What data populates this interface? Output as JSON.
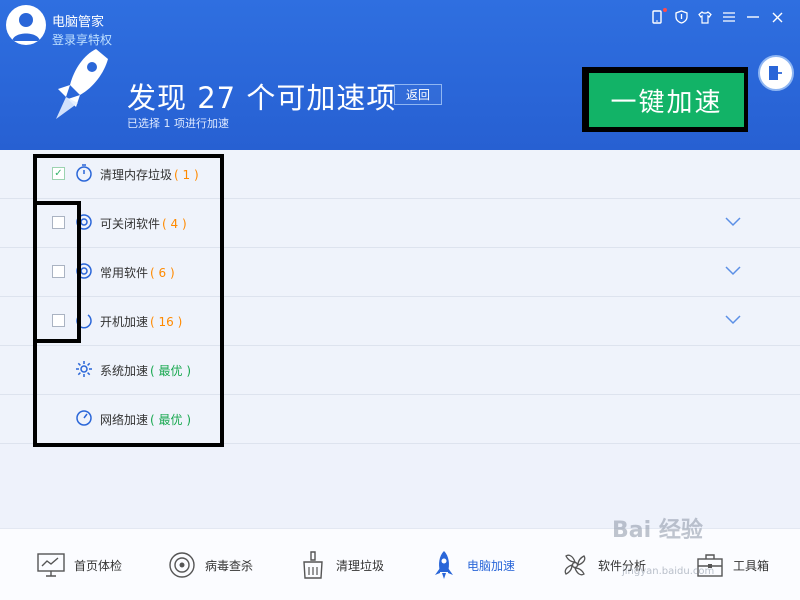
{
  "header": {
    "app_title": "电脑管家",
    "login_link": "登录享特权",
    "headline": "发现 27 个可加速项",
    "back_label": "返回",
    "subline": "已选择 1 项进行加速",
    "accelerate_label": "一键加速"
  },
  "items": [
    {
      "label": "清理内存垃圾",
      "count": "( 1 )",
      "checked": true
    },
    {
      "label": "可关闭软件",
      "count": "( 4 )",
      "checked": false
    },
    {
      "label": "常用软件",
      "count": "( 6 )",
      "checked": false
    },
    {
      "label": "开机加速",
      "count": "( 16 )",
      "checked": false
    },
    {
      "label": "系统加速",
      "count": "( 最优 )"
    },
    {
      "label": "网络加速",
      "count": "( 最优 )"
    }
  ],
  "nav": [
    {
      "label": "首页体检"
    },
    {
      "label": "病毒查杀"
    },
    {
      "label": "清理垃圾"
    },
    {
      "label": "电脑加速"
    },
    {
      "label": "软件分析"
    },
    {
      "label": "工具箱"
    }
  ],
  "watermark": {
    "text": "Bai 经验",
    "sub": "jingyan.baidu.com"
  },
  "colors": {
    "header_blue": "#2a66d8",
    "accent_green": "#12b367",
    "count_orange": "#ff8a00",
    "count_green": "#18a84f"
  }
}
